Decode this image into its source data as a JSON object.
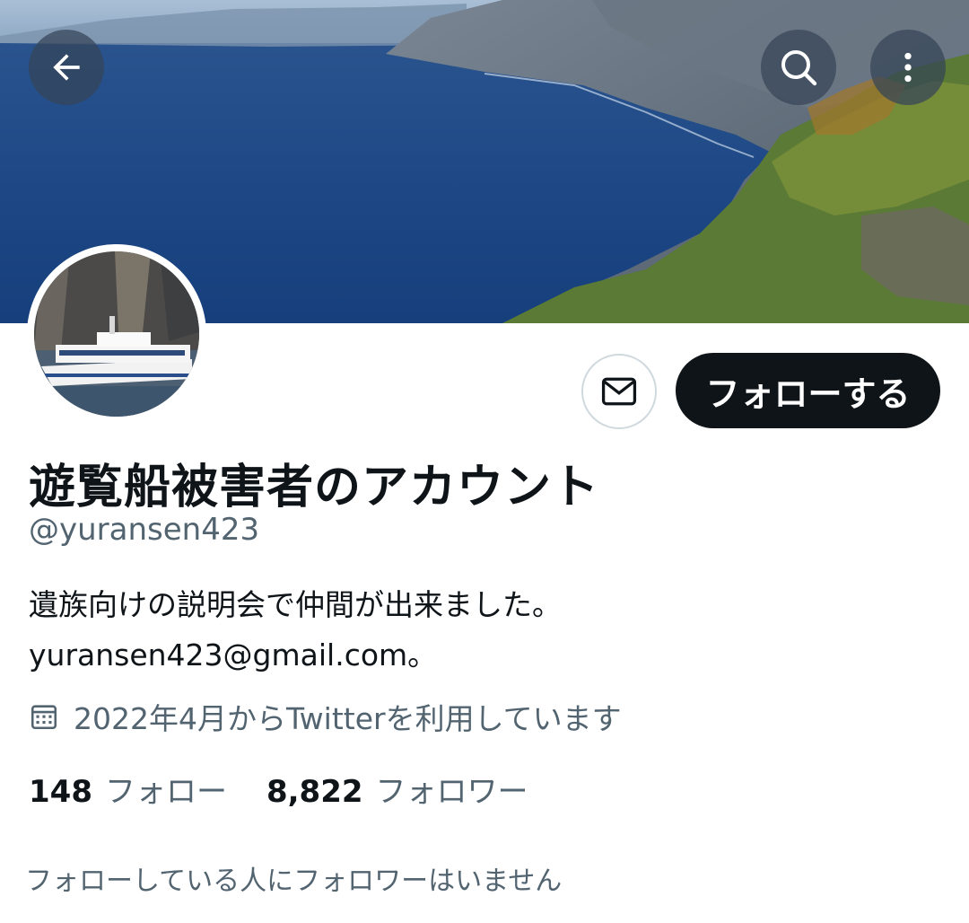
{
  "header": {
    "back": {
      "icon": "arrow-left-icon"
    },
    "search": {
      "icon": "search-icon"
    },
    "more": {
      "icon": "more-vertical-icon"
    }
  },
  "banner": {
    "description_icon": "banner-image"
  },
  "profile": {
    "display_name": "遊覧船被害者のアカウント",
    "handle": "@yuransen423",
    "bio_lines": [
      "遺族向けの説明会で仲間が出来ました。",
      "yuransen423@gmail.com。"
    ],
    "joined": "2022年4月からTwitterを利用しています",
    "following_count": "148",
    "following_label": "フォロー",
    "followers_count": "8,822",
    "followers_label": "フォロワー",
    "followed_by_note": "フォローしている人にフォロワーはいません"
  },
  "actions": {
    "message_icon": "envelope-icon",
    "follow_label": "フォローする"
  },
  "colors": {
    "follow_button_bg": "#0f1419",
    "secondary_text": "#536471",
    "border": "#cfd9de"
  }
}
